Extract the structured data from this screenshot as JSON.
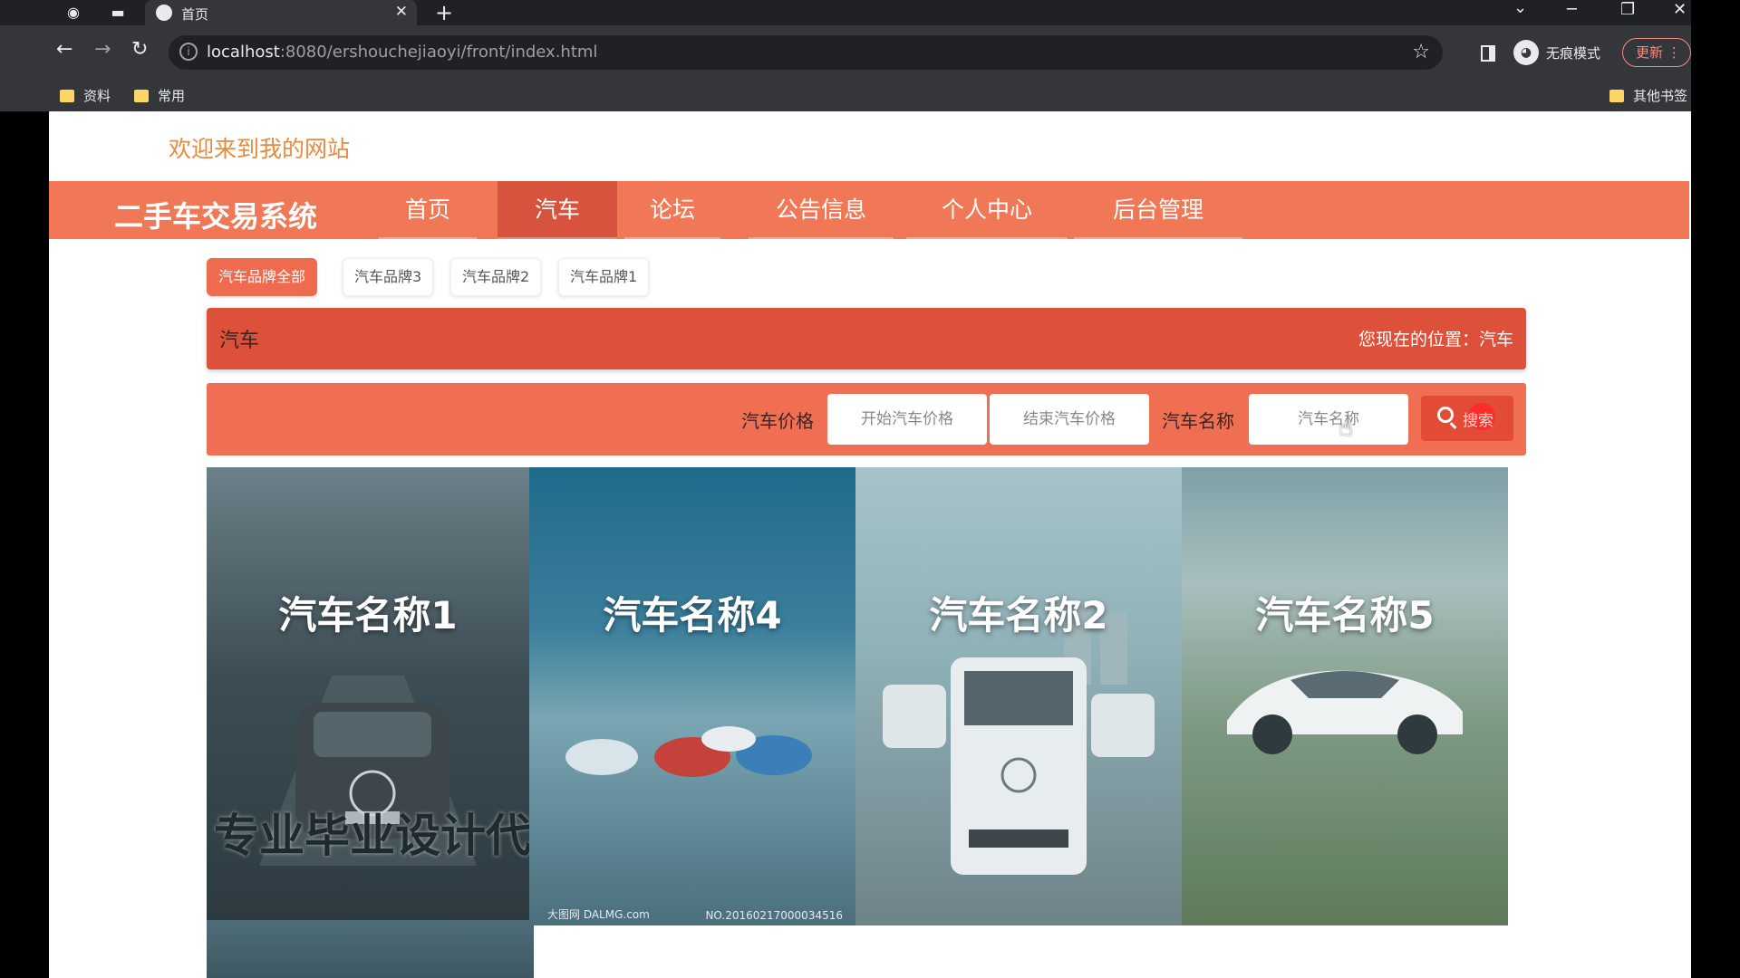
{
  "browser": {
    "tab_title": "首页",
    "url_host": "localhost",
    "url_rest": ":8080/ershouchejiaoyi/front/index.html",
    "incognito_label": "无痕模式",
    "update_label": "更新",
    "bookmarks": [
      "资料",
      "常用"
    ],
    "other_bookmarks": "其他书签"
  },
  "site": {
    "welcome": "欢迎来到我的网站",
    "brand": "二手车交易系统",
    "nav": [
      "首页",
      "汽车",
      "论坛",
      "公告信息",
      "个人中心",
      "后台管理"
    ],
    "nav_active": "汽车"
  },
  "filters": {
    "brand_tags": [
      "汽车品牌全部",
      "汽车品牌3",
      "汽车品牌2",
      "汽车品牌1"
    ]
  },
  "section": {
    "title": "汽车",
    "location": "您现在的位置：汽车"
  },
  "search": {
    "price_label": "汽车价格",
    "start_price_placeholder": "开始汽车价格",
    "end_price_placeholder": "结束汽车价格",
    "name_label": "汽车名称",
    "name_placeholder": "汽车名称",
    "button_label": "搜索"
  },
  "cards": [
    {
      "name": "汽车名称1",
      "overlay": "专业毕业设计代"
    },
    {
      "name": "汽车名称4",
      "watermark_left": "大图网 DALMG.com",
      "watermark_right": "NO.20160217000034516"
    },
    {
      "name": "汽车名称2"
    },
    {
      "name": "汽车名称5"
    }
  ]
}
